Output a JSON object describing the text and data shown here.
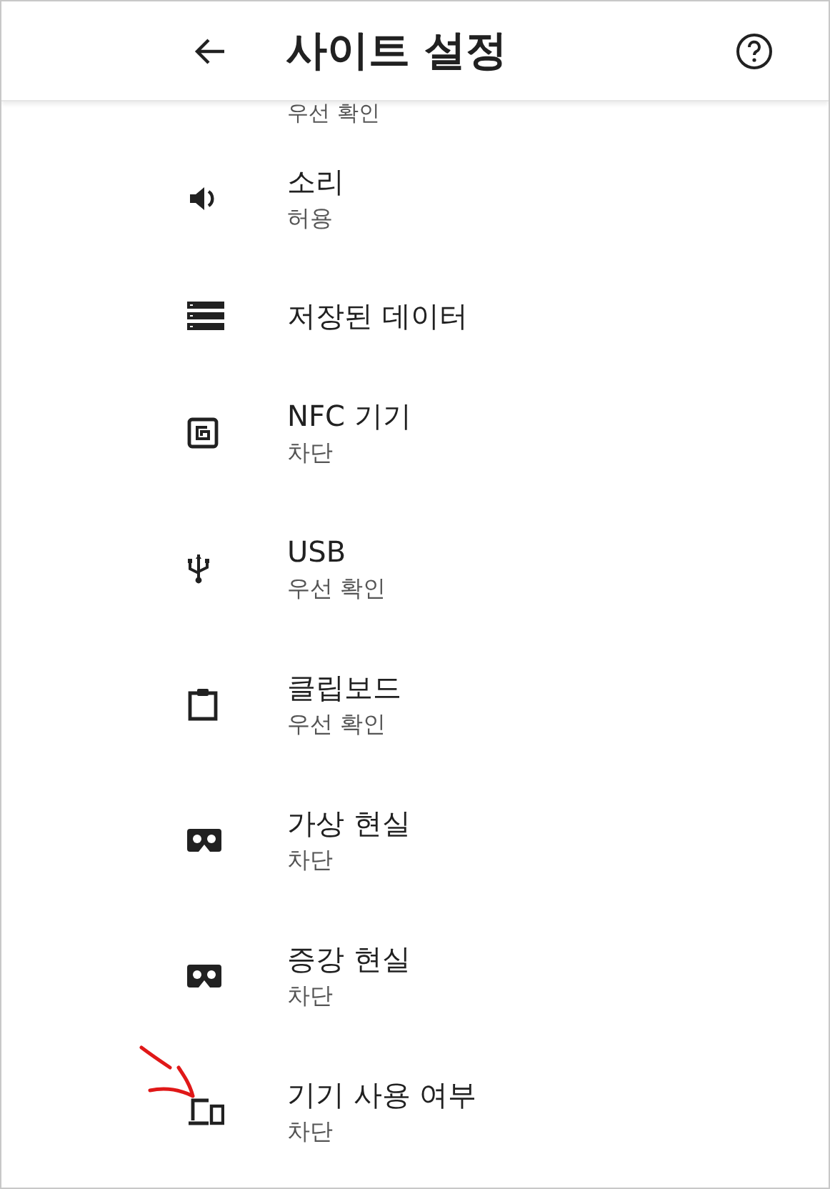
{
  "header": {
    "title": "사이트 설정"
  },
  "partial_status": "우선 확인",
  "items": [
    {
      "kind": "speaker",
      "title": "소리",
      "status": "허용"
    },
    {
      "kind": "storage",
      "title": "저장된 데이터"
    },
    {
      "kind": "nfc",
      "title": "NFC 기기",
      "status": "차단"
    },
    {
      "kind": "usb",
      "title": "USB",
      "status": "우선 확인"
    },
    {
      "kind": "clipboard",
      "title": "클립보드",
      "status": "우선 확인"
    },
    {
      "kind": "goggles",
      "title": "가상 현실",
      "status": "차단"
    },
    {
      "kind": "goggles",
      "title": "증강 현실",
      "status": "차단"
    },
    {
      "kind": "devices",
      "title": "기기 사용 여부",
      "status": "차단"
    }
  ]
}
